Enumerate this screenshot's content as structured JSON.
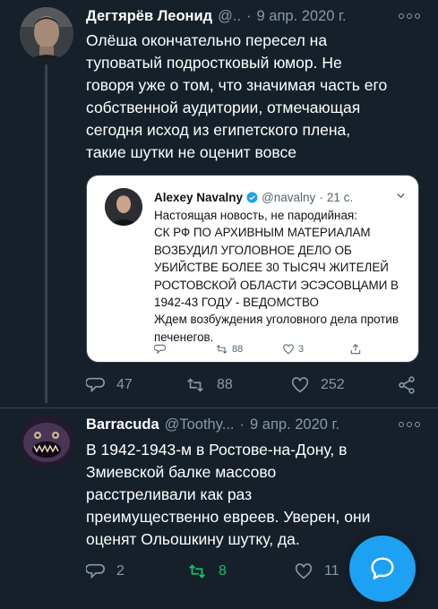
{
  "tweet1": {
    "name": "Дегтярёв Леонид",
    "handle": "@..",
    "date": "9 апр. 2020 г.",
    "text": "Олёша окончательно пересел на туповатый подростковый юмор. Не говоря уже о том, что значимая часть его собственной аудитории, отмечающая сегодня исход из египетского плена, такие шутки не оценит вовсе",
    "replies": "47",
    "retweets": "88",
    "likes": "252",
    "icons": [
      "reply-icon",
      "retweet-icon",
      "like-icon",
      "share-icon"
    ]
  },
  "quote": {
    "name": "Alexey Navalny",
    "handle": "@navalny",
    "time": "21 с.",
    "text_intro": "Настоящая новость, не пародийная:",
    "text_caps": "СК РФ ПО АРХИВНЫМ МАТЕРИАЛАМ ВОЗБУДИЛ УГОЛОВНОЕ ДЕЛО ОБ УБИЙСТВЕ БОЛЕЕ 30 ТЫСЯЧ ЖИТЕЛЕЙ РОСТОВСКОЙ ОБЛАСТИ ЭСЭСОВЦАМИ В 1942-43 ГОДУ - ВЕДОМСТВО",
    "text_outro": "Ждем возбуждения уголовного дела против печенегов.",
    "retweets": "88",
    "likes": "3"
  },
  "tweet2": {
    "name": "Barracuda",
    "handle": "@Toothy...",
    "date": "9 апр. 2020 г.",
    "text": "В 1942-1943-м в Ростове-на-Дону, в Змиевской балке массово расстреливали как раз преимущественно евреев. Уверен, они оценят Ольошкину шутку, да.",
    "replies": "2",
    "retweets": "8",
    "likes": "11"
  },
  "colors": {
    "background": "#15202b",
    "secondary_text": "#8899a6",
    "accent": "#1da1f2",
    "retweeted": "#17bf63"
  }
}
